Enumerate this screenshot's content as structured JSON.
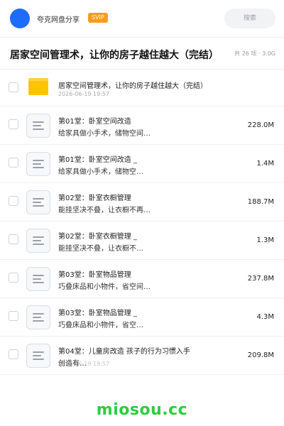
{
  "header": {
    "share_name": "夸克网盘分享",
    "badge": "SVIP",
    "search_label": "搜索"
  },
  "folder": {
    "title": "居家空间管理术，让你的房子越住越大（完结）",
    "meta": "共 26 项 · 3.0G"
  },
  "items": [
    {
      "name": "居家空间管理术，让你的房子越住越大（完结）",
      "date": "2026-06-19 19:57",
      "type": "folder"
    },
    {
      "name": "第01堂：卧室空间改造",
      "sub": "给家具做小手术，储物空间…",
      "size": "228.0M",
      "date": "",
      "type": "doc"
    },
    {
      "name": "第01堂：卧室空间改造 _",
      "sub": "给家具做小手术，储物空…",
      "size": "1.4M",
      "date": "",
      "type": "doc"
    },
    {
      "name": "第02堂：卧室衣橱管理",
      "sub": "能挂坚决不叠，让衣橱不再…",
      "size": "188.7M",
      "date": "",
      "type": "doc"
    },
    {
      "name": "第02堂：卧室衣橱管理 _",
      "sub": "能挂坚决不叠，让衣橱不…",
      "size": "1.3M",
      "date": "",
      "type": "doc"
    },
    {
      "name": "第03堂：卧室物品管理",
      "sub": "巧叠床品和小物件，省空间…",
      "size": "237.8M",
      "date": "",
      "type": "doc"
    },
    {
      "name": "第03堂：卧室物品管理 _",
      "sub": "巧叠床品和小物件，省空…",
      "size": "4.3M",
      "date": "",
      "type": "doc"
    },
    {
      "name": "第04堂：儿童房改造 孩子的行为习惯入手",
      "sub": "创造有…",
      "size": "209.8M",
      "date": "2026-06-19 19:57",
      "type": "doc"
    }
  ],
  "watermark": "miosou.cc"
}
